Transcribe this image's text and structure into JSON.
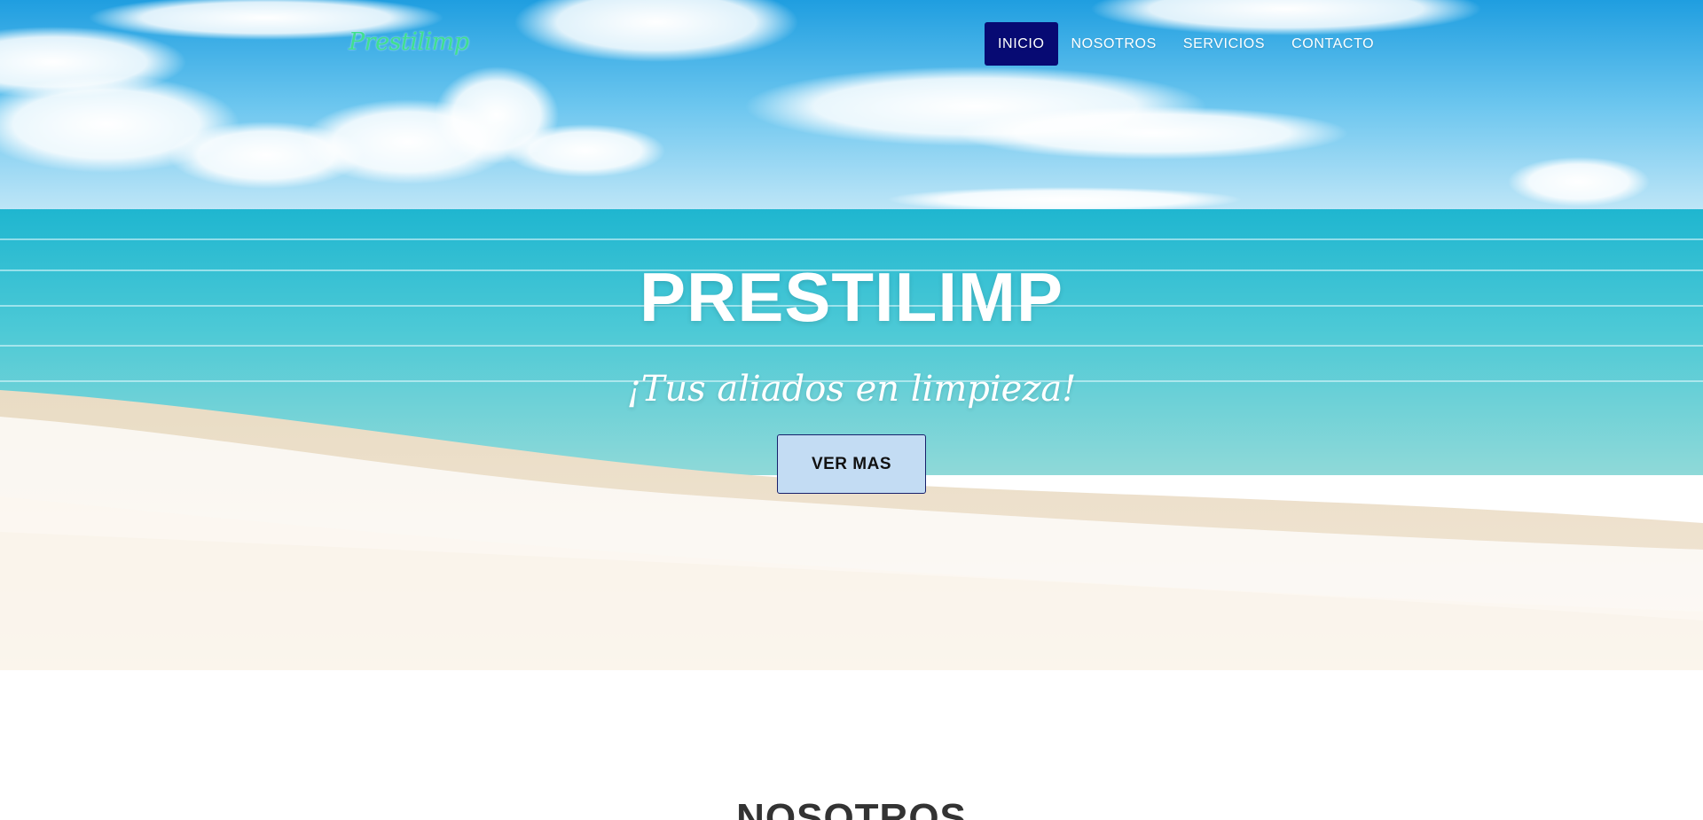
{
  "brand": {
    "logo_text": "Prestilimp"
  },
  "nav": {
    "items": [
      {
        "label": "INICIO",
        "active": true
      },
      {
        "label": "NOSOTROS",
        "active": false
      },
      {
        "label": "SERVICIOS",
        "active": false
      },
      {
        "label": "CONTACTO",
        "active": false
      }
    ]
  },
  "hero": {
    "title": "PRESTILIMP",
    "subtitle": "¡Tus aliados en limpieza!",
    "cta_label": "VER MAS",
    "background": "beach-sea-sky-photo"
  },
  "about": {
    "heading": "NOSOTROS"
  },
  "colors": {
    "nav_active_bg": "#070a73",
    "logo": "#3fe08f",
    "cta_bg": "#c3dcf3",
    "cta_border": "#17206b"
  }
}
